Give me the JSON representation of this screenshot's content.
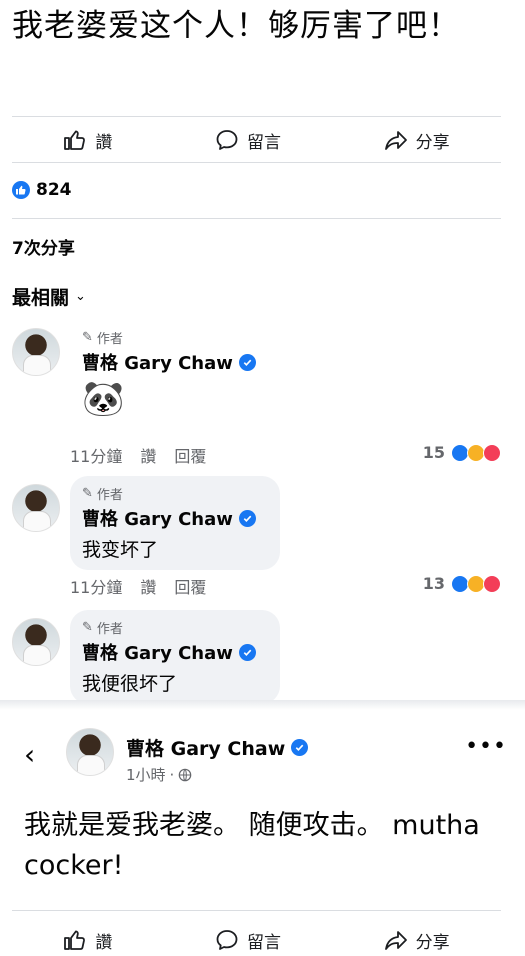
{
  "post": {
    "text": "我老婆爱这个人！够厉害了吧！",
    "actions": {
      "like": "讚",
      "comment": "留言",
      "share": "分享"
    },
    "reaction_count": "824",
    "shares": "7次分享",
    "sort_label": "最相關"
  },
  "comments": [
    {
      "author_tag": "作者",
      "name": "曹格 Gary Chaw",
      "text": "🐼",
      "time": "11分鐘",
      "like": "讚",
      "reply": "回覆",
      "count": "15"
    },
    {
      "author_tag": "作者",
      "name": "曹格 Gary Chaw",
      "text": "我变坏了",
      "time": "11分鐘",
      "like": "讚",
      "reply": "回覆",
      "count": "13"
    },
    {
      "author_tag": "作者",
      "name": "曹格 Gary Chaw",
      "text": "我便很坏了"
    }
  ],
  "second_post": {
    "author": "曹格 Gary Chaw",
    "time": "1小時",
    "text": "我就是爱我老婆。 随便攻击。 mutha cocker!",
    "actions": {
      "like": "讚",
      "comment": "留言",
      "share": "分享"
    }
  },
  "colors": {
    "accent": "#1877f2",
    "secondary_text": "#65676b",
    "bubble": "#f0f2f5"
  }
}
